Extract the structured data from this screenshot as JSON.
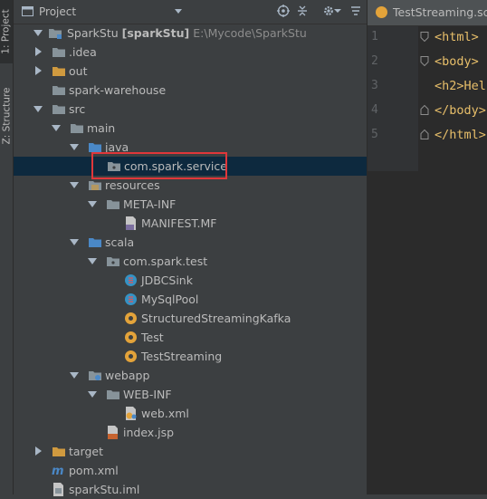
{
  "side_tabs": [
    {
      "label": "1: Project"
    },
    {
      "label": "Z: Structure"
    }
  ],
  "panel": {
    "title": "Project"
  },
  "tree": [
    {
      "label": "SparkStu",
      "module": "[sparkStu]",
      "path": "E:\\Mycode\\SparkStu",
      "icon": "module-folder-icon"
    },
    {
      "label": ".idea",
      "icon": "folder-icon"
    },
    {
      "label": "out",
      "icon": "excluded-folder-icon"
    },
    {
      "label": "spark-warehouse",
      "icon": "folder-icon"
    },
    {
      "label": "src",
      "icon": "folder-icon"
    },
    {
      "label": "main",
      "icon": "folder-icon"
    },
    {
      "label": "java",
      "icon": "source-folder-icon"
    },
    {
      "label": "com.spark.service",
      "icon": "package-icon"
    },
    {
      "label": "resources",
      "icon": "resources-folder-icon"
    },
    {
      "label": "META-INF",
      "icon": "folder-icon"
    },
    {
      "label": "MANIFEST.MF",
      "icon": "manifest-file-icon"
    },
    {
      "label": "scala",
      "icon": "source-folder-icon"
    },
    {
      "label": "com.spark.test",
      "icon": "package-icon"
    },
    {
      "label": "JDBCSink",
      "icon": "scala-class-icon"
    },
    {
      "label": "MySqlPool",
      "icon": "scala-class-icon"
    },
    {
      "label": "StructuredStreamingKafka",
      "icon": "scala-object-icon"
    },
    {
      "label": "Test",
      "icon": "scala-object-icon"
    },
    {
      "label": "TestStreaming",
      "icon": "scala-object-icon"
    },
    {
      "label": "webapp",
      "icon": "web-folder-icon"
    },
    {
      "label": "WEB-INF",
      "icon": "folder-icon"
    },
    {
      "label": "web.xml",
      "icon": "xml-file-icon"
    },
    {
      "label": "index.jsp",
      "icon": "jsp-file-icon"
    },
    {
      "label": "target",
      "icon": "excluded-folder-icon"
    },
    {
      "label": "pom.xml",
      "icon": "maven-icon"
    },
    {
      "label": "sparkStu.iml",
      "icon": "iml-file-icon"
    }
  ],
  "editor": {
    "tab_label": "TestStreaming.scala",
    "line_numbers": [
      "1",
      "2",
      "3",
      "4",
      "5"
    ],
    "lines": [
      "<html>",
      "<body>",
      "<h2>Hel",
      "</body>",
      "</html>"
    ]
  },
  "colors": {
    "selection": "#0d293e",
    "highlight_box": "#e0373a",
    "folder": "#87939a",
    "source_folder": "#4a88c7",
    "excluded_folder": "#d09a3f",
    "scala_class": "#3592c4",
    "scala_object": "#e3a33a"
  }
}
